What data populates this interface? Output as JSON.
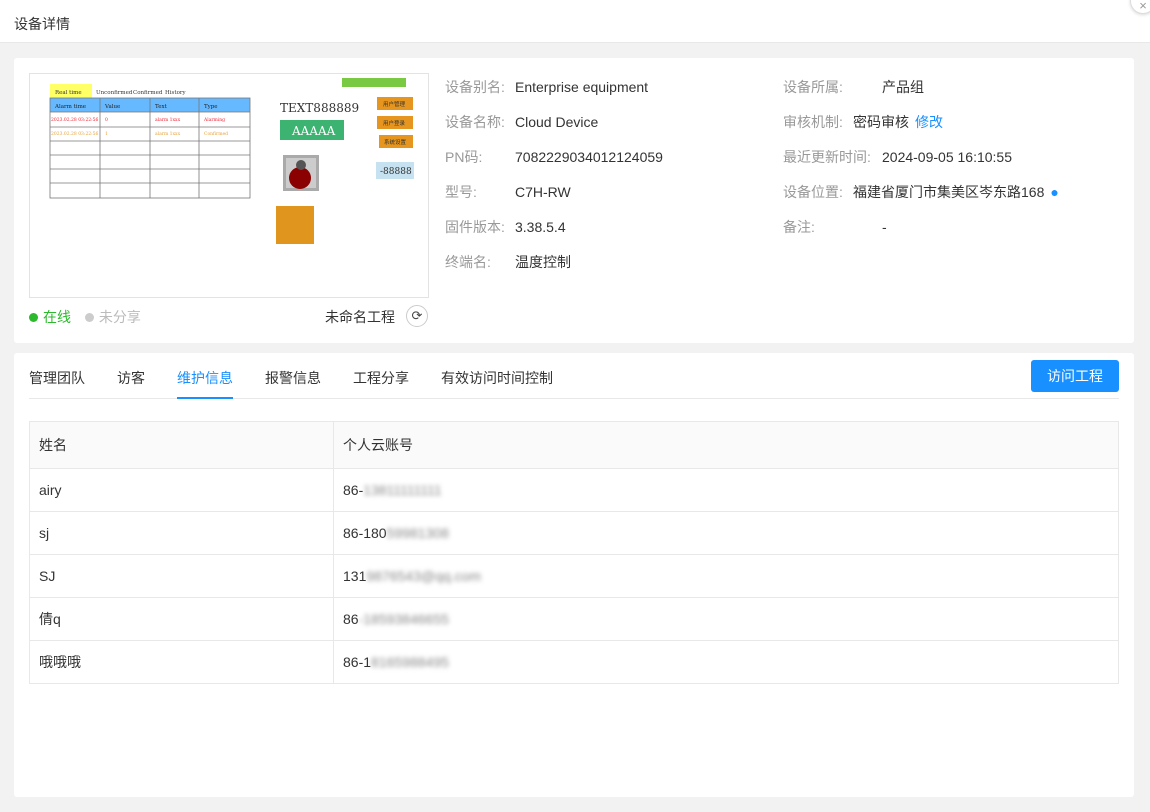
{
  "window": {
    "title": "设备详情",
    "close_icon": "×"
  },
  "preview": {
    "table_tabs": [
      "Real time",
      "Unconfirmed",
      "Confirmed",
      "History"
    ],
    "table_headers": [
      "Alarm time",
      "Value",
      "Text",
      "Type"
    ],
    "table_rows": [
      [
        "2023.02.28 03:22:56",
        "0",
        "alarm 1xxx",
        "Alarming"
      ],
      [
        "2023.02.28 03:22:56",
        "1",
        "alarm 1xxx",
        "Confirmed"
      ]
    ],
    "text_label": "TEXT888889",
    "green_button": "AAAAA",
    "side_buttons": [
      "用户管理",
      "用户登录",
      "系统设置"
    ],
    "number_display": "-88888"
  },
  "status": {
    "online": "在线",
    "unshared": "未分享",
    "online_color": "#2db92d"
  },
  "project": {
    "name": "未命名工程",
    "refresh_icon": "refresh-icon"
  },
  "info": {
    "alias_label": "设备别名:",
    "alias_value": "Enterprise equipment",
    "name_label": "设备名称:",
    "name_value": "Cloud Device",
    "pn_label": "PN码:",
    "pn_value": "7082229034012124059",
    "model_label": "型号:",
    "model_value": "C7H-RW",
    "firmware_label": "固件版本:",
    "firmware_value": "3.38.5.4",
    "terminal_label": "终端名:",
    "terminal_value": "温度控制",
    "group_label": "设备所属:",
    "group_value": "产品组",
    "audit_label": "审核机制:",
    "audit_value": "密码审核",
    "audit_link": "修改",
    "updated_label": "最近更新时间:",
    "updated_value": "2024-09-05 16:10:55",
    "location_label": "设备位置:",
    "location_value": "福建省厦门市集美区岑东路168",
    "note_label": "备注:",
    "note_value": "-"
  },
  "tabs": [
    "管理团队",
    "访客",
    "维护信息",
    "报警信息",
    "工程分享",
    "有效访问时间控制"
  ],
  "active_tab": "维护信息",
  "visit_button": "访问工程",
  "table": {
    "headers": [
      "姓名",
      "个人云账号"
    ],
    "rows": [
      {
        "name": "airy",
        "prefix": "86-",
        "masked": "13811111111"
      },
      {
        "name": "sj",
        "prefix": "86-180",
        "masked": "59981308"
      },
      {
        "name": "SJ",
        "prefix": "131",
        "masked": "9876543@qq.com"
      },
      {
        "name": "倩q",
        "prefix": "86",
        "masked": "-18593846655"
      },
      {
        "name": "哦哦哦",
        "prefix": "86-1",
        "masked": "8165988495"
      }
    ]
  },
  "colors": {
    "accent": "#1890ff",
    "online": "#2db92d"
  }
}
